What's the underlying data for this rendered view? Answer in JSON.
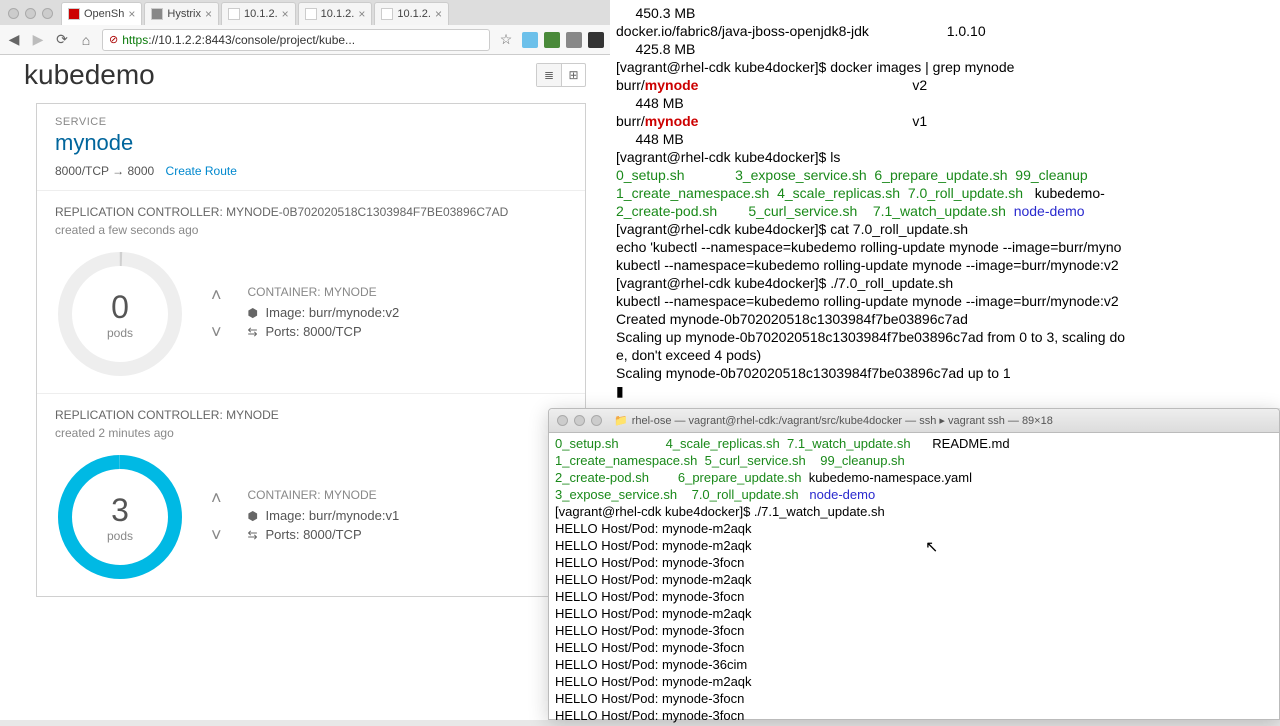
{
  "browser": {
    "tabs": [
      {
        "label": "OpenSh",
        "icon": "red"
      },
      {
        "label": "Hystrix",
        "icon": "gray"
      },
      {
        "label": "10.1.2.",
        "icon": "page"
      },
      {
        "label": "10.1.2.",
        "icon": "page"
      },
      {
        "label": "10.1.2.",
        "icon": "page"
      }
    ],
    "url_https": "https",
    "url_rest": "://10.1.2.2:8443/console/project/kube..."
  },
  "console": {
    "project": "kubedemo",
    "service_label": "SERVICE",
    "service_name": "mynode",
    "route_text": "8000/TCP → 8000",
    "create_route": "Create Route",
    "rc": [
      {
        "title": "REPLICATION CONTROLLER: MYNODE-0B702020518C1303984F7BE03896C7AD",
        "age": "created a few seconds ago",
        "count": "0",
        "pods": "pods",
        "cont_label": "CONTAINER: MYNODE",
        "image": "Image: burr/mynode:v2",
        "ports": "Ports: 8000/TCP",
        "ring": "empty"
      },
      {
        "title": "REPLICATION CONTROLLER: MYNODE",
        "age": "created 2 minutes ago",
        "count": "3",
        "pods": "pods",
        "cont_label": "CONTAINER: MYNODE",
        "image": "Image: burr/mynode:v1",
        "ports": "Ports: 8000/TCP",
        "ring": "full"
      }
    ]
  },
  "term1": {
    "lines": [
      {
        "t": "     450.3 MB"
      },
      {
        "t": "docker.io/fabric8/java-jboss-openjdk8-jdk                    1.0.10"
      },
      {
        "t": "     425.8 MB"
      },
      {
        "spans": [
          {
            "t": "[vagrant@rhel-cdk kube4docker]$ docker images | grep mynode"
          }
        ]
      },
      {
        "spans": [
          {
            "t": "burr/",
            "c": ""
          },
          {
            "t": "mynode",
            "c": "red"
          },
          {
            "t": "                                                       v2"
          }
        ]
      },
      {
        "t": "     448 MB"
      },
      {
        "spans": [
          {
            "t": "burr/"
          },
          {
            "t": "mynode",
            "c": "red"
          },
          {
            "t": "                                                       v1"
          }
        ]
      },
      {
        "t": "     448 MB"
      },
      {
        "t": "[vagrant@rhel-cdk kube4docker]$ ls"
      },
      {
        "spans": [
          {
            "t": "0_setup.sh",
            "c": "grn"
          },
          {
            "t": "             "
          },
          {
            "t": "3_expose_service.sh",
            "c": "grn"
          },
          {
            "t": "  "
          },
          {
            "t": "6_prepare_update.sh",
            "c": "grn"
          },
          {
            "t": "  "
          },
          {
            "t": "99_cleanup",
            "c": "grn"
          }
        ]
      },
      {
        "spans": [
          {
            "t": "1_create_namespace.sh",
            "c": "grn"
          },
          {
            "t": "  "
          },
          {
            "t": "4_scale_replicas.sh",
            "c": "grn"
          },
          {
            "t": "  "
          },
          {
            "t": "7.0_roll_update.sh",
            "c": "grn"
          },
          {
            "t": "   kubedemo-"
          }
        ]
      },
      {
        "spans": [
          {
            "t": "2_create-pod.sh",
            "c": "grn"
          },
          {
            "t": "        "
          },
          {
            "t": "5_curl_service.sh",
            "c": "grn"
          },
          {
            "t": "    "
          },
          {
            "t": "7.1_watch_update.sh",
            "c": "grn"
          },
          {
            "t": "  "
          },
          {
            "t": "node-demo",
            "c": "blu"
          }
        ]
      },
      {
        "t": "[vagrant@rhel-cdk kube4docker]$ cat 7.0_roll_update.sh"
      },
      {
        "t": "echo 'kubectl --namespace=kubedemo rolling-update mynode --image=burr/myno"
      },
      {
        "t": "kubectl --namespace=kubedemo rolling-update mynode --image=burr/mynode:v2"
      },
      {
        "t": "[vagrant@rhel-cdk kube4docker]$ ./7.0_roll_update.sh"
      },
      {
        "t": "kubectl --namespace=kubedemo rolling-update mynode --image=burr/mynode:v2"
      },
      {
        "t": "Created mynode-0b702020518c1303984f7be03896c7ad"
      },
      {
        "t": "Scaling up mynode-0b702020518c1303984f7be03896c7ad from 0 to 3, scaling do"
      },
      {
        "t": "e, don't exceed 4 pods)"
      },
      {
        "t": "Scaling mynode-0b702020518c1303984f7be03896c7ad up to 1"
      },
      {
        "t": "▮"
      }
    ]
  },
  "term2title": "rhel-ose — vagrant@rhel-cdk:/vagrant/src/kube4docker — ssh ▸ vagrant ssh — 89×18",
  "term2": {
    "lines": [
      {
        "spans": [
          {
            "t": "0_setup.sh",
            "c": "grn"
          },
          {
            "t": "             "
          },
          {
            "t": "4_scale_replicas.sh",
            "c": "grn"
          },
          {
            "t": "  "
          },
          {
            "t": "7.1_watch_update.sh",
            "c": "grn"
          },
          {
            "t": "      README.md"
          }
        ]
      },
      {
        "spans": [
          {
            "t": "1_create_namespace.sh",
            "c": "grn"
          },
          {
            "t": "  "
          },
          {
            "t": "5_curl_service.sh",
            "c": "grn"
          },
          {
            "t": "    "
          },
          {
            "t": "99_cleanup.sh",
            "c": "grn"
          }
        ]
      },
      {
        "spans": [
          {
            "t": "2_create-pod.sh",
            "c": "grn"
          },
          {
            "t": "        "
          },
          {
            "t": "6_prepare_update.sh",
            "c": "grn"
          },
          {
            "t": "  kubedemo-namespace.yaml"
          }
        ]
      },
      {
        "spans": [
          {
            "t": "3_expose_service.sh",
            "c": "grn"
          },
          {
            "t": "    "
          },
          {
            "t": "7.0_roll_update.sh",
            "c": "grn"
          },
          {
            "t": "   "
          },
          {
            "t": "node-demo",
            "c": "blu"
          }
        ]
      },
      {
        "t": "[vagrant@rhel-cdk kube4docker]$ ./7.1_watch_update.sh"
      },
      {
        "t": "HELLO Host/Pod: mynode-m2aqk"
      },
      {
        "t": "HELLO Host/Pod: mynode-m2aqk"
      },
      {
        "t": "HELLO Host/Pod: mynode-3focn"
      },
      {
        "t": "HELLO Host/Pod: mynode-m2aqk"
      },
      {
        "t": "HELLO Host/Pod: mynode-3focn"
      },
      {
        "t": "HELLO Host/Pod: mynode-m2aqk"
      },
      {
        "t": "HELLO Host/Pod: mynode-3focn"
      },
      {
        "t": "HELLO Host/Pod: mynode-3focn"
      },
      {
        "t": "HELLO Host/Pod: mynode-36cim"
      },
      {
        "t": "HELLO Host/Pod: mynode-m2aqk"
      },
      {
        "t": "HELLO Host/Pod: mynode-3focn"
      },
      {
        "t": "HELLO Host/Pod: mynode-3focn"
      }
    ]
  }
}
